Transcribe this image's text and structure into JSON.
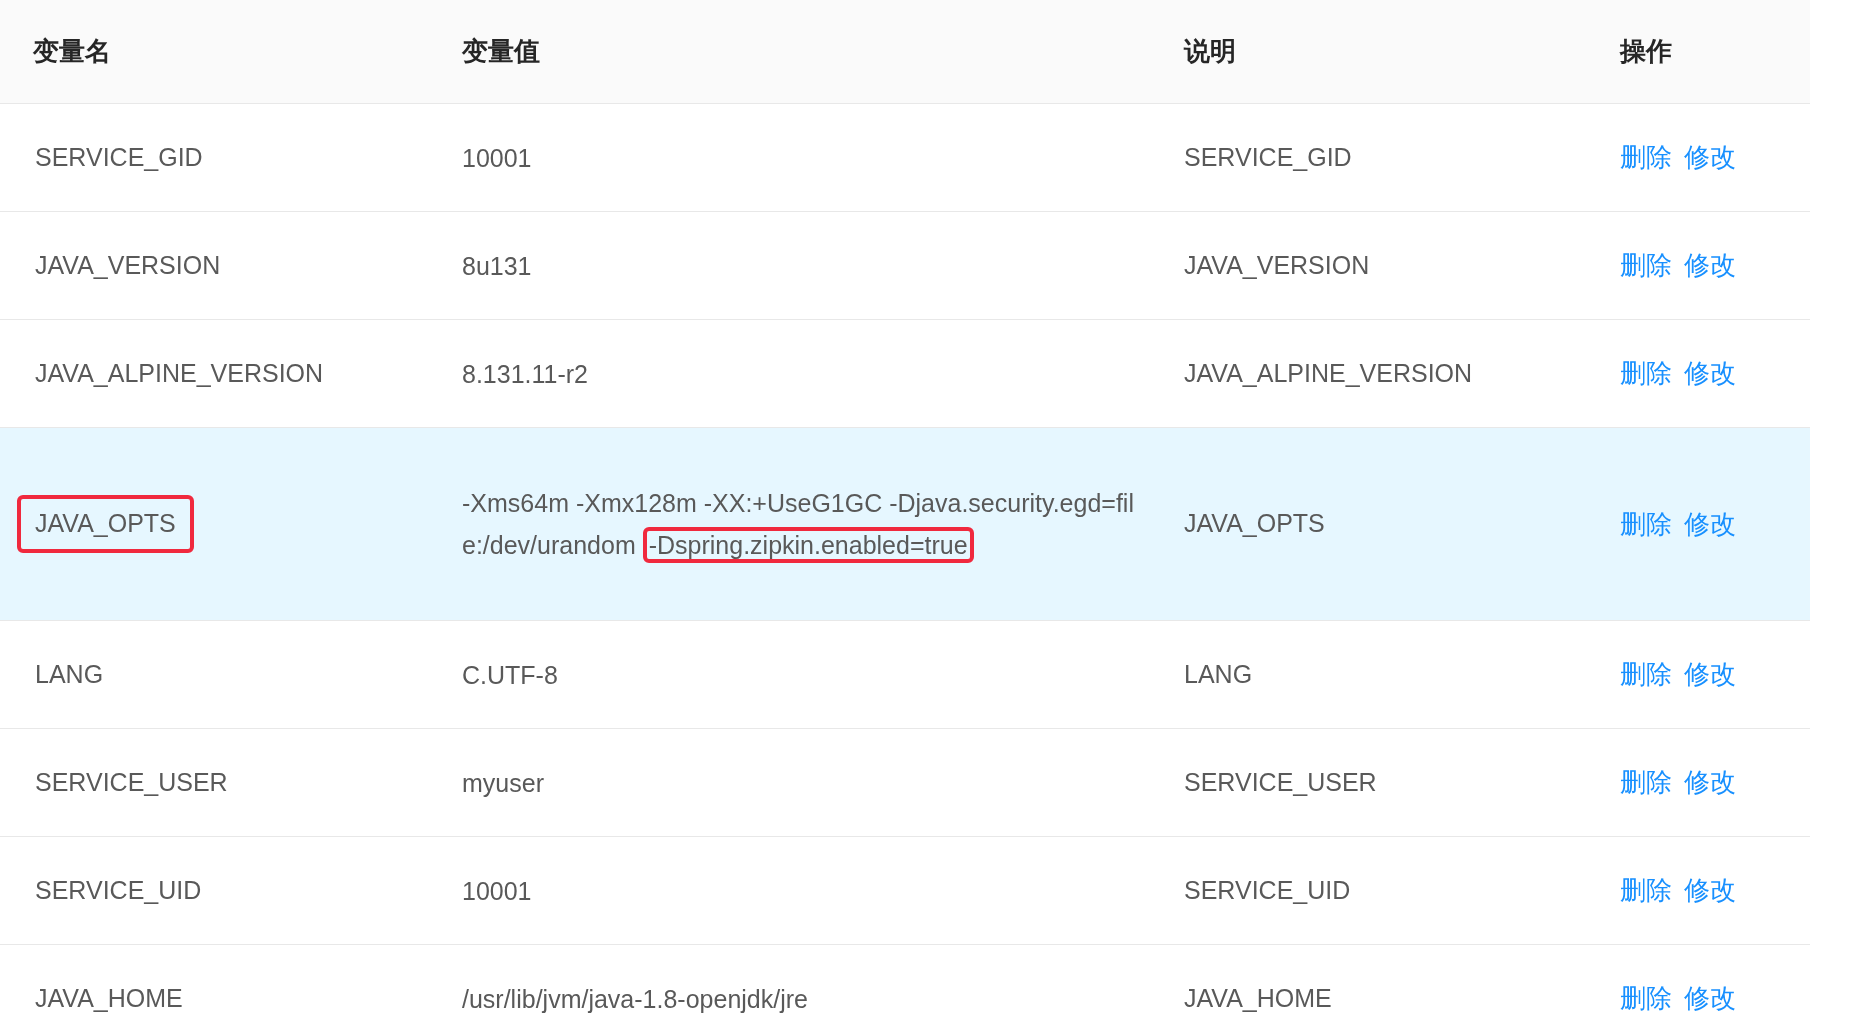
{
  "table": {
    "columns": [
      "变量名",
      "变量值",
      "说明",
      "操作"
    ],
    "rows": [
      {
        "name": "SERVICE_GID",
        "name_highlighted": false,
        "value": [
          {
            "text": "10001",
            "highlighted": false
          }
        ],
        "description": "SERVICE_GID",
        "actions": [
          "删除",
          "修改"
        ],
        "selected": false
      },
      {
        "name": "JAVA_VERSION",
        "name_highlighted": false,
        "value": [
          {
            "text": "8u131",
            "highlighted": false
          }
        ],
        "description": "JAVA_VERSION",
        "actions": [
          "删除",
          "修改"
        ],
        "selected": false
      },
      {
        "name": "JAVA_ALPINE_VERSION",
        "name_highlighted": false,
        "value": [
          {
            "text": "8.131.11-r2",
            "highlighted": false
          }
        ],
        "description": "JAVA_ALPINE_VERSION",
        "actions": [
          "删除",
          "修改"
        ],
        "selected": false
      },
      {
        "name": "JAVA_OPTS",
        "name_highlighted": true,
        "value": [
          {
            "text": "-Xms64m -Xmx128m -XX:+UseG1GC -Djava.security.egd=file:/dev/urandom",
            "highlighted": false
          },
          {
            "text": "-Dspring.zipkin.enabled=true",
            "highlighted": true
          }
        ],
        "description": "JAVA_OPTS",
        "actions": [
          "删除",
          "修改"
        ],
        "selected": true
      },
      {
        "name": "LANG",
        "name_highlighted": false,
        "value": [
          {
            "text": "C.UTF-8",
            "highlighted": false
          }
        ],
        "description": "LANG",
        "actions": [
          "删除",
          "修改"
        ],
        "selected": false
      },
      {
        "name": "SERVICE_USER",
        "name_highlighted": false,
        "value": [
          {
            "text": "myuser",
            "highlighted": false
          }
        ],
        "description": "SERVICE_USER",
        "actions": [
          "删除",
          "修改"
        ],
        "selected": false
      },
      {
        "name": "SERVICE_UID",
        "name_highlighted": false,
        "value": [
          {
            "text": "10001",
            "highlighted": false
          }
        ],
        "description": "SERVICE_UID",
        "actions": [
          "删除",
          "修改"
        ],
        "selected": false
      },
      {
        "name": "JAVA_HOME",
        "name_highlighted": false,
        "value": [
          {
            "text": "/usr/lib/jvm/java-1.8-openjdk/jre",
            "highlighted": false
          }
        ],
        "description": "JAVA_HOME",
        "actions": [
          "删除",
          "修改"
        ],
        "selected": false
      }
    ]
  }
}
